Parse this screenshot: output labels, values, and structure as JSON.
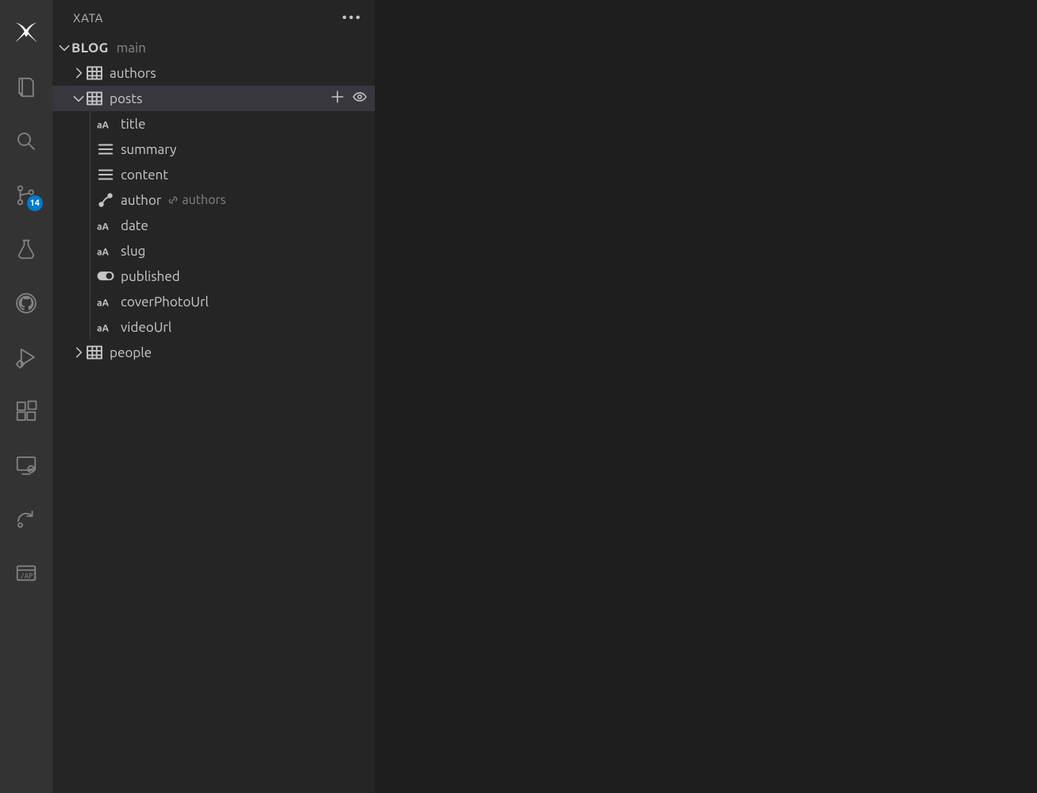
{
  "panel": {
    "title": "XATA"
  },
  "database": {
    "name": "BLOG",
    "branch": "main"
  },
  "tables": {
    "authors": {
      "label": "authors"
    },
    "posts": {
      "label": "posts"
    },
    "people": {
      "label": "people"
    }
  },
  "posts_columns": {
    "title": {
      "label": "title"
    },
    "summary": {
      "label": "summary"
    },
    "content": {
      "label": "content"
    },
    "author": {
      "label": "author",
      "linked_table": "authors"
    },
    "date": {
      "label": "date"
    },
    "slug": {
      "label": "slug"
    },
    "published": {
      "label": "published"
    },
    "coverPhotoUrl": {
      "label": "coverPhotoUrl"
    },
    "videoUrl": {
      "label": "videoUrl"
    }
  },
  "source_control_badge": "14"
}
